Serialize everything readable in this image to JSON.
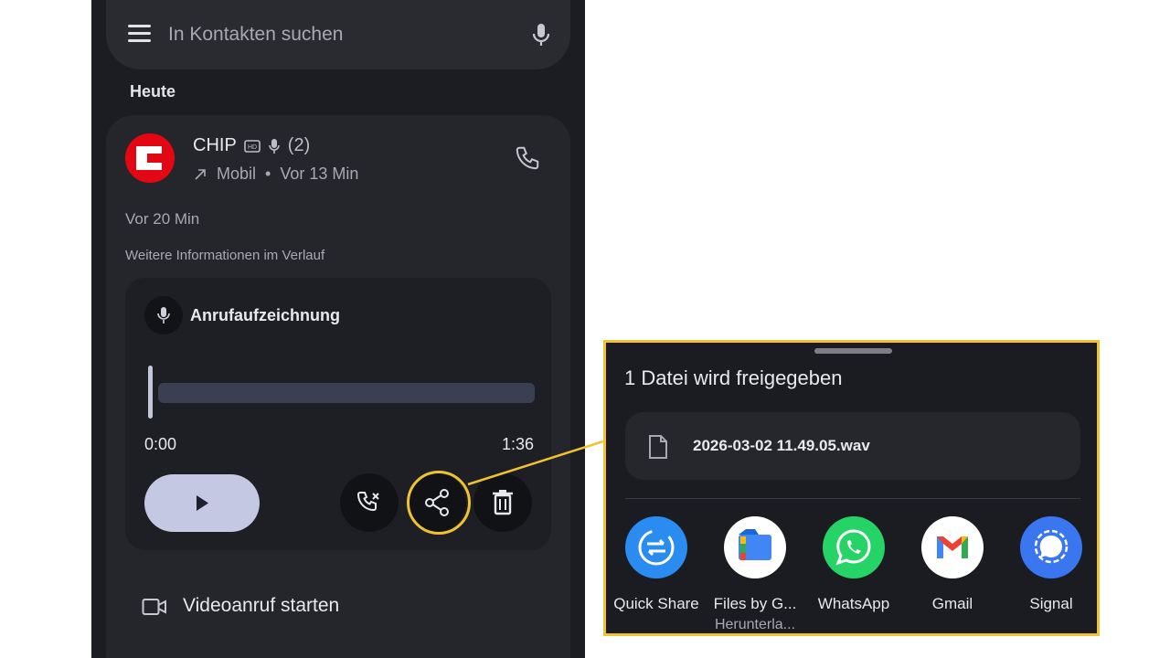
{
  "search": {
    "placeholder": "In Kontakten suchen"
  },
  "section_label": "Heute",
  "contact": {
    "name": "CHIP",
    "count": "(2)",
    "type": "Mobil",
    "separator": "•",
    "time": "Vor 13 Min"
  },
  "call_time": "Vor 20 Min",
  "more_info": "Weitere Informationen im Verlauf",
  "recording": {
    "title": "Anrufaufzeichnung",
    "current_time": "0:00",
    "duration": "1:36",
    "progress": 0
  },
  "video_call_label": "Videoanruf starten",
  "share_sheet": {
    "title": "1 Datei wird freigegeben",
    "file_name": "2026-03-02 11.49.05.wav",
    "apps": [
      {
        "name": "Quick Share",
        "sub": ""
      },
      {
        "name": "Files by G...",
        "sub": "Herunterla..."
      },
      {
        "name": "WhatsApp",
        "sub": ""
      },
      {
        "name": "Gmail",
        "sub": ""
      },
      {
        "name": "Signal",
        "sub": ""
      }
    ]
  },
  "colors": {
    "highlight": "#f0c232",
    "chip_red": "#e30613",
    "quick_share_blue": "#2a8cf0",
    "whatsapp_green": "#25d366",
    "signal_blue": "#3a76f0"
  }
}
